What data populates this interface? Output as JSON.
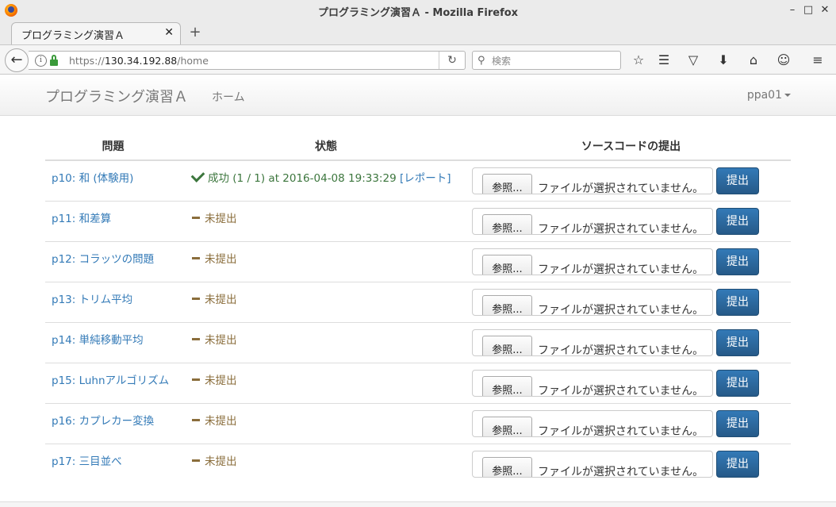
{
  "window": {
    "title": "プログラミング演習Ａ - Mozilla Firefox",
    "minimize": "–",
    "maximize": "□",
    "close": "✕"
  },
  "tab": {
    "title": "プログラミング演習Ａ",
    "close": "✕",
    "new_tab": "+"
  },
  "urlbar": {
    "scheme": "https://",
    "host": "130.34.192.88",
    "path": "/home"
  },
  "search": {
    "placeholder": "検索"
  },
  "app": {
    "brand": "プログラミング演習Ａ",
    "nav_home": "ホーム",
    "user": "ppa01"
  },
  "table": {
    "headers": [
      "問題",
      "状態",
      "ソースコードの提出"
    ],
    "browse_label": "参照...",
    "no_file_label": "ファイルが選択されていません。",
    "submit_label": "提出",
    "rows": [
      {
        "problem": "p10: 和 (体験用)",
        "status": "成功 (1 / 1) at 2016-04-08 19:33:29",
        "report": "[レポート]",
        "state": "success"
      },
      {
        "problem": "p11: 和差算",
        "status": "未提出",
        "state": "pending"
      },
      {
        "problem": "p12: コラッツの問題",
        "status": "未提出",
        "state": "pending"
      },
      {
        "problem": "p13: トリム平均",
        "status": "未提出",
        "state": "pending"
      },
      {
        "problem": "p14: 単純移動平均",
        "status": "未提出",
        "state": "pending"
      },
      {
        "problem": "p15: Luhnアルゴリズム",
        "status": "未提出",
        "state": "pending"
      },
      {
        "problem": "p16: カプレカー変換",
        "status": "未提出",
        "state": "pending"
      },
      {
        "problem": "p17: 三目並べ",
        "status": "未提出",
        "state": "pending"
      }
    ]
  },
  "colors": {
    "link": "#337ab7",
    "success": "#3c763d",
    "pending": "#8a6d3b",
    "primary_button": "#2e6da4"
  }
}
